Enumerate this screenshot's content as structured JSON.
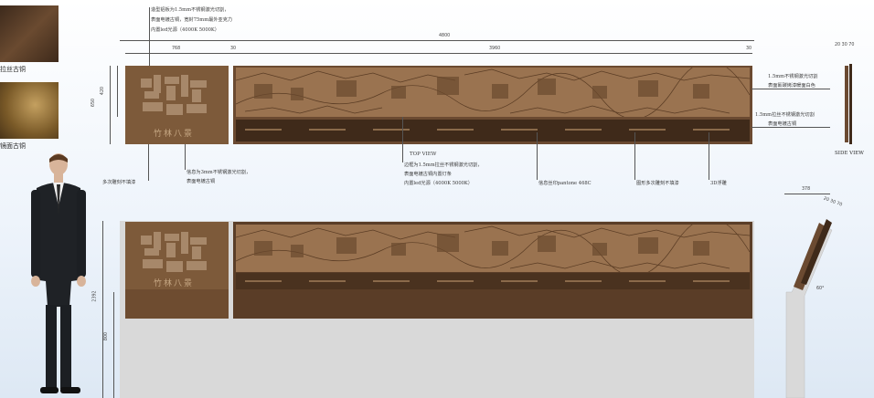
{
  "swatches": [
    {
      "label": "拉丝古铜",
      "color_a": "#4a3322",
      "color_b": "#6e4e33"
    },
    {
      "label": "镜面古铜",
      "color_a": "#7a5a2a",
      "color_b": "#b18a4a"
    }
  ],
  "top_note": {
    "lines": [
      "造型铝板为1.5mm不锈钢激光切割，",
      "表面电镀古铜，宽封75mm最外亚克力",
      "内置led光源（4000K 5000K）"
    ]
  },
  "dims": {
    "total": "4800",
    "left": "768",
    "gap1": "30",
    "mid": "3960",
    "gap2": "30",
    "h1": "650",
    "h2": "420",
    "side_a": "20",
    "side_b": "30",
    "side_c": "70",
    "tall": "2392",
    "base": "800",
    "side2_w": "378",
    "side2_a": "20",
    "side2_b": "30",
    "side2_c": "70",
    "angle": "60°"
  },
  "logo_text": "竹林八景",
  "right_notes": [
    [
      "1.5mm不锈钢激光切割",
      "表面氟碳烤漆暖面白色"
    ],
    [
      "1.5mm拉丝不锈钢激光切割",
      "表面电镀古铜"
    ]
  ],
  "bottom_notes": {
    "left1": "多次雕刻不填漆",
    "left2_lines": [
      "信息为3mm不锈钢激光切割，",
      "表面电镀古铜"
    ],
    "top_view": "TOP VIEW",
    "mid_lines": [
      "边框为1.5mm拉丝不锈钢激光切割，",
      "表面电镀古铜内置灯条",
      "内置led光源（4000K 5000K）"
    ],
    "pantone": "信息丝印pantone 468C",
    "multi": "图形多次雕刻不填漆",
    "relief": "3D浮雕"
  },
  "side_view": "SIDE VIEW",
  "colors": {
    "bronze": "#7a5638",
    "dark": "#3f2a1a",
    "wall": "#d9d9d9",
    "engrave": "#c49a6a"
  }
}
